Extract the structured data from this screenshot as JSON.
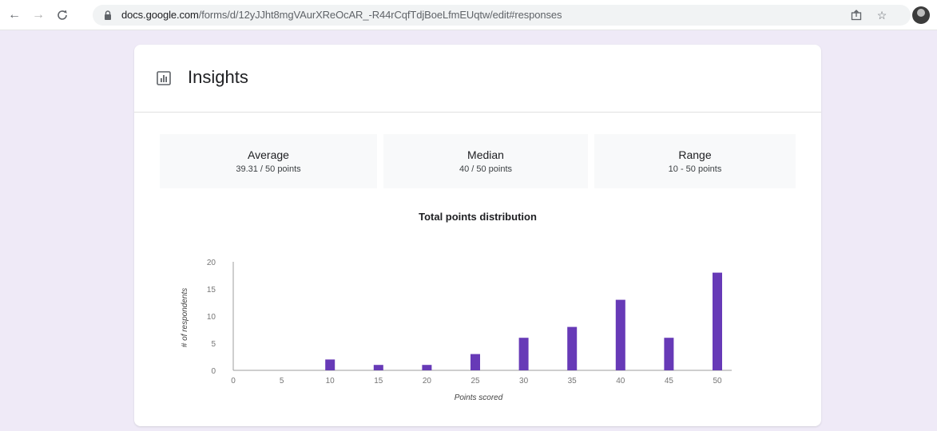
{
  "browser": {
    "url_host": "docs.google.com",
    "url_path": "/forms/d/12yJJht8mgVAurXReOcAR_-R44rCqfTdjBoeLfmEUqtw/edit#responses"
  },
  "insights": {
    "title": "Insights",
    "stats": [
      {
        "label": "Average",
        "value": "39.31 / 50 points"
      },
      {
        "label": "Median",
        "value": "40 / 50 points"
      },
      {
        "label": "Range",
        "value": "10 - 50 points"
      }
    ]
  },
  "chart_data": {
    "type": "bar",
    "title": "Total points distribution",
    "xlabel": "Points scored",
    "ylabel": "# of respondents",
    "x_ticks": [
      0,
      5,
      10,
      15,
      20,
      25,
      30,
      35,
      40,
      45,
      50
    ],
    "y_ticks": [
      0,
      5,
      10,
      15,
      20
    ],
    "ylim": [
      0,
      20
    ],
    "xlim": [
      0,
      50
    ],
    "grid": false,
    "bar_color": "#673ab7",
    "categories": [
      10,
      15,
      20,
      25,
      30,
      35,
      40,
      45,
      50
    ],
    "values": [
      2,
      1,
      1,
      3,
      6,
      8,
      13,
      6,
      18
    ]
  }
}
